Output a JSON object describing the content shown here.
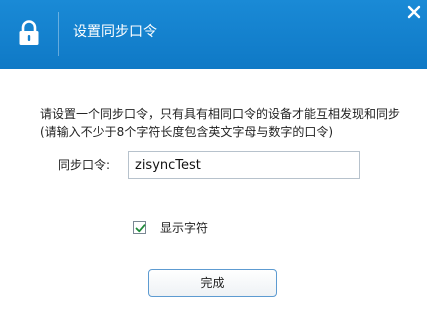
{
  "dialog": {
    "title": "设置同步口令",
    "instruction_line1": "请设置一个同步口令，只有具有相同口令的设备才能互相发现和同步",
    "instruction_line2": "(请输入不少于8个字符长度包含英文字母与数字的口令)",
    "field_label": "同步口令:",
    "field_value": "zisyncTest",
    "show_chars_label": "显示字符",
    "show_chars_checked": true,
    "done_label": "完成"
  },
  "icons": {
    "title_icon": "lock-icon",
    "close_icon": "close-icon",
    "check_icon": "checkmark-icon"
  },
  "colors": {
    "titlebar": "#1581cf",
    "title_text": "#ffffff",
    "button_border": "#5d9bd1",
    "check_mark": "#1f8a3a"
  }
}
